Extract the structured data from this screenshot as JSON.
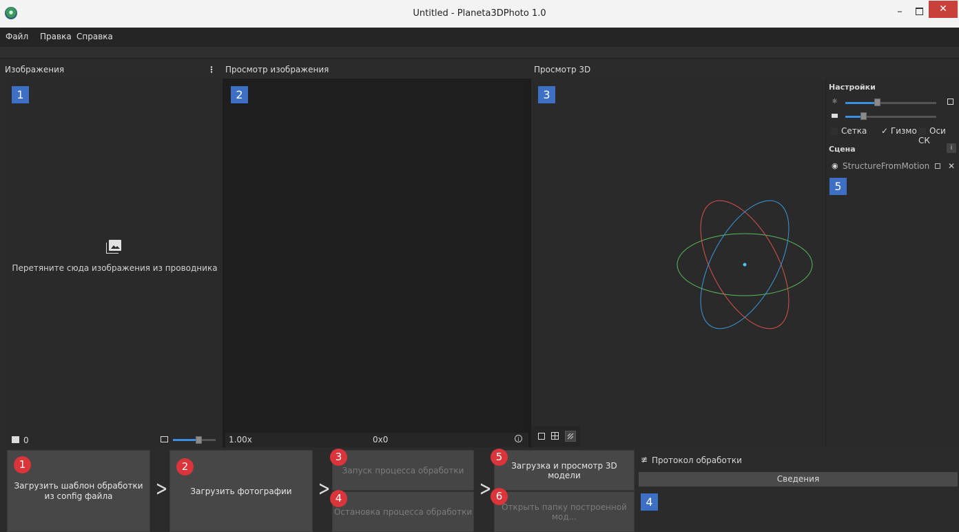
{
  "window": {
    "title": "Untitled - Planeta3DPhoto 1.0",
    "minimize": "–",
    "close": "✕"
  },
  "menu": [
    "Файл",
    "Правка",
    "Справка"
  ],
  "panels": {
    "images": {
      "title": "Изображения",
      "more": "⋮",
      "badge": "1",
      "drop_hint": "Перетяните сюда изображения из проводника",
      "count": "0"
    },
    "preview": {
      "title": "Просмотр изображения",
      "badge": "2",
      "zoom": "1.00x",
      "size": "0x0"
    },
    "view3d": {
      "title": "Просмотр 3D",
      "badge": "3"
    },
    "settings": {
      "title": "Настройки",
      "slider1_level": 0.35,
      "slider2_level": 0.2,
      "grid_label": "Сетка",
      "gizmo_label": "Гизмо",
      "gizmo_check": "✓",
      "axes_label": "Оси СК",
      "scene_title": "Сцена",
      "scene_info": "i",
      "scene_item": "StructureFromMotion",
      "scene_badge": "5",
      "remove": "✕"
    }
  },
  "actions": [
    {
      "badge": "1",
      "label": "Загрузить шаблон обработки\nиз config файла",
      "enabled": true
    },
    {
      "badge": "2",
      "label": "Загрузить фотографии",
      "enabled": true
    },
    {
      "badge": "3",
      "label": "Запуск процесса обработки",
      "enabled": false
    },
    {
      "badge": "4",
      "label": "Остановка процесса обработки",
      "enabled": false
    },
    {
      "badge": "5",
      "label": "Загрузка и просмотр 3D модели",
      "enabled": true
    },
    {
      "badge": "6",
      "label": "Открыть папку построенной мод...",
      "enabled": false
    }
  ],
  "log": {
    "title": "Протокол обработки",
    "tab": "Сведения",
    "badge": "4",
    "icon": "≢"
  },
  "colors": {
    "badge_blue": "#3d6fc5",
    "badge_red": "#d9353a",
    "accent": "#3b8fe0",
    "orbit_red": "#d9534f",
    "orbit_blue": "#3a9ad9",
    "orbit_green": "#5cb85c",
    "center": "#4fc3f7"
  }
}
